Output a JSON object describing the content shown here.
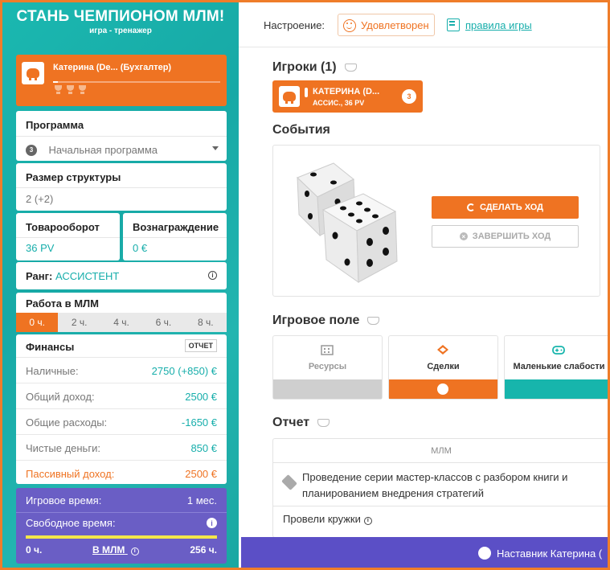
{
  "brand": {
    "title": "СТАНЬ ЧЕМПИОНОМ МЛМ!",
    "subtitle": "игра - тренажер"
  },
  "player_card": {
    "name": "Катерина (De...  (Бухгалтер)",
    "progress": 0.03
  },
  "program": {
    "label": "Программа",
    "badge": "3",
    "value": "Начальная программа"
  },
  "structure": {
    "label": "Размер структуры",
    "value": "2 (+2)"
  },
  "turnover": {
    "label": "Товарооборот",
    "value": "36 PV"
  },
  "reward": {
    "label": "Вознаграждение",
    "value": "0 €"
  },
  "rank": {
    "label": "Ранг:",
    "value": "АССИСТЕНТ"
  },
  "work": {
    "label": "Работа в МЛМ",
    "tabs": [
      "0 ч.",
      "2 ч.",
      "4 ч.",
      "6 ч.",
      "8 ч."
    ],
    "active": 0
  },
  "finance": {
    "title": "Финансы",
    "report_button": "ОТЧЕТ",
    "rows": [
      {
        "k": "Наличные:",
        "v": "2750 (+850) €"
      },
      {
        "k": "Общий доход:",
        "v": "2500 €"
      },
      {
        "k": "Общие расходы:",
        "v": "-1650 €"
      },
      {
        "k": "Чистые деньги:",
        "v": "850 €"
      },
      {
        "k": "Пассивный доход:",
        "v": "2500 €"
      }
    ]
  },
  "time": {
    "game_label": "Игровое время:",
    "game_value": "1 мес.",
    "free_label": "Свободное время:",
    "left": "0 ч.",
    "mlm_link": "В МЛМ",
    "right": "256 ч."
  },
  "topbar": {
    "mood_label": "Настроение:",
    "mood_value": "Удовлетворен",
    "rules_link": "правила игры"
  },
  "players": {
    "title": "Игроки (1)",
    "chip_name": "КАТЕРИНА (D...",
    "chip_sub": "АССИС., 36 PV",
    "chip_badge": "3"
  },
  "events": {
    "title": "События",
    "make_move": "СДЕЛАТЬ ХОД",
    "end_move": "ЗАВЕРШИТЬ ХОД"
  },
  "board": {
    "title": "Игровое поле",
    "cards": [
      "Ресурсы",
      "Сделки",
      "Маленькие слабости"
    ]
  },
  "report": {
    "title": "Отчет",
    "column": "МЛМ",
    "item1": "Проведение серии мастер-классов с разбором книги и планированием внедрения стратегий",
    "item2": "Провели кружки"
  },
  "mentor": {
    "text": "Наставник Катерина ("
  },
  "colors": {
    "orange": "#ef7322",
    "teal": "#17aeab",
    "purple": "#6a5ec5"
  }
}
